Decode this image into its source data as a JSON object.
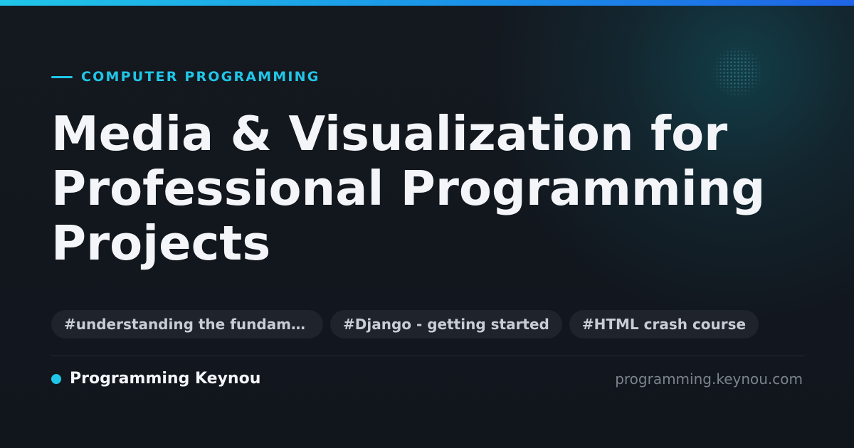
{
  "header": {
    "category": "COMPUTER PROGRAMMING",
    "title": "Media & Visualization for Professional Programming Projects"
  },
  "tags": [
    "#understanding the fundamentals",
    "#Django - getting started",
    "#HTML crash course"
  ],
  "footer": {
    "brand": "Programming Keynou",
    "url": "programming.keynou.com"
  },
  "colors": {
    "accent": "#20c6e8",
    "background": "#12171e",
    "title_text": "#f3f5f8",
    "tag_background": "#1e232c",
    "tag_text": "#c9cdd4",
    "muted_text": "#7c838e"
  },
  "icons": {
    "category_marker": "dash-line",
    "brand_marker": "circle-dot"
  }
}
